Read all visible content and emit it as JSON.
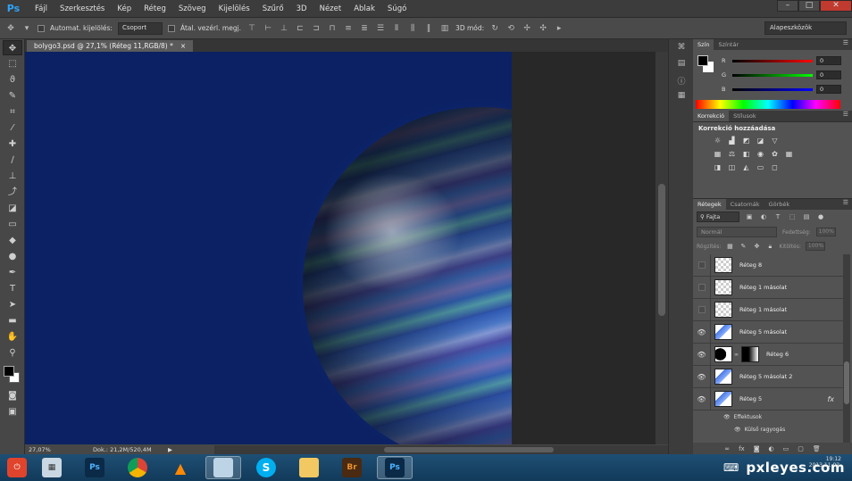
{
  "app": {
    "logo": "Ps",
    "menu": [
      "Fájl",
      "Szerkesztés",
      "Kép",
      "Réteg",
      "Szöveg",
      "Kijelölés",
      "Szűrő",
      "3D",
      "Nézet",
      "Ablak",
      "Súgó"
    ],
    "window_buttons": [
      "–",
      "□",
      "✕"
    ]
  },
  "options_bar": {
    "tool_icon": "move-icon",
    "auto_select_label": "Automat. kijelölés:",
    "auto_select_value": "Csoport",
    "transform_label": "Átal. vezérl. megj.",
    "mode_label": "3D mód:",
    "workspace": "Alapeszközök"
  },
  "document": {
    "tab_title": "bolygo3.psd @ 27,1% (Réteg 11,RGB/8) *",
    "tab_close": "×",
    "zoom": "27,07%",
    "doc_size": "Dok.: 21,2M/520,4M"
  },
  "color_panel": {
    "tabs": [
      "Szín",
      "Színtár"
    ],
    "sliders": [
      {
        "label": "R",
        "value": "0"
      },
      {
        "label": "G",
        "value": "0"
      },
      {
        "label": "B",
        "value": "0"
      }
    ]
  },
  "adjustments_panel": {
    "tabs": [
      "Korrekció",
      "Stílusok"
    ],
    "title": "Korrekció hozzáadása"
  },
  "layers_panel": {
    "tabs": [
      "Rétegek",
      "Csatornák",
      "Görbék"
    ],
    "kind": "Fajta",
    "blend_mode": "Normál",
    "opacity_label": "Fedettség:",
    "opacity_value": "100%",
    "lock_label": "Rögzítés:",
    "fill_label": "Kitöltés:",
    "fill_value": "100%",
    "layers": [
      {
        "name": "Réteg 8",
        "visible": false,
        "thumb": "transparent"
      },
      {
        "name": "Réteg 1 másolat",
        "visible": false,
        "thumb": "transparent"
      },
      {
        "name": "Réteg 1 másolat",
        "visible": false,
        "thumb": "transparent"
      },
      {
        "name": "Réteg 5 másolat",
        "visible": true,
        "thumb": "planet"
      },
      {
        "name": "Réteg 6",
        "visible": true,
        "thumb": "mask"
      },
      {
        "name": "Réteg 5 másolat 2",
        "visible": true,
        "thumb": "planet"
      },
      {
        "name": "Réteg 5",
        "visible": true,
        "thumb": "planet",
        "fx": "fx"
      }
    ],
    "effects_label": "Effektusok",
    "effect_item": "Külső ragyogás"
  },
  "taskbar": {
    "apps": [
      "power-app",
      "calculator-app",
      "photoshop-app",
      "chrome-app",
      "vlc-app",
      "window-app",
      "skype-app",
      "explorer-app",
      "bridge-app",
      "photoshop-active-app"
    ],
    "watermark": "pxleyes.com",
    "time": "19:12",
    "date": "2013.11.02."
  }
}
